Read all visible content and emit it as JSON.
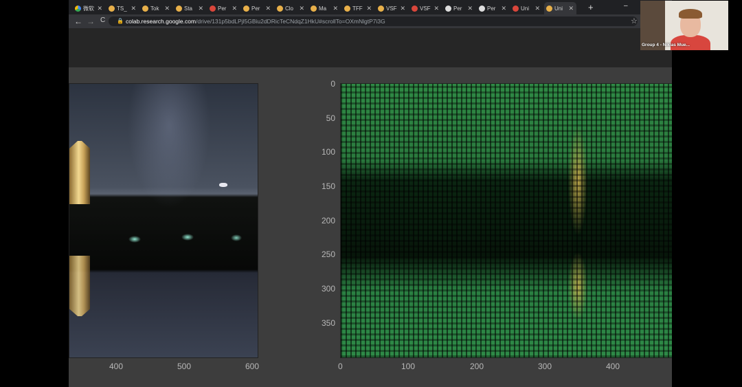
{
  "browser": {
    "tabs": [
      {
        "label": "微软",
        "icon": "google-drive-icon"
      },
      {
        "label": "TS_",
        "icon": "colab-icon"
      },
      {
        "label": "Tok",
        "icon": "colab-icon"
      },
      {
        "label": "Sta",
        "icon": "colab-icon"
      },
      {
        "label": "Per",
        "icon": "red-logo-icon"
      },
      {
        "label": "Per",
        "icon": "colab-icon"
      },
      {
        "label": "Clo",
        "icon": "colab-icon"
      },
      {
        "label": "Ma",
        "icon": "colab-icon"
      },
      {
        "label": "TFF",
        "icon": "colab-icon"
      },
      {
        "label": "VSF",
        "icon": "colab-icon"
      },
      {
        "label": "VSF",
        "icon": "red-logo-icon"
      },
      {
        "label": "Per",
        "icon": "github-icon"
      },
      {
        "label": "Per",
        "icon": "github-icon"
      },
      {
        "label": "Uni",
        "icon": "red-logo-icon"
      },
      {
        "label": "Uni",
        "icon": "colab-icon"
      }
    ],
    "new_tab": "+",
    "window_controls": [
      "–",
      "❐",
      "✕"
    ],
    "nav": {
      "back": "←",
      "forward": "→",
      "reload": "C"
    },
    "url_host": "colab.research.google.com",
    "url_path": "/drive/131p5bdLPjl5GBiu2dDRicTeCNdqZ1HkU#scrollTo=OXmNlgtP7i3G"
  },
  "meeting": {
    "participant_label": "Group 4 - Niklas Mue..."
  },
  "left_plot": {
    "x_ticks": [
      "400",
      "500",
      "600"
    ]
  },
  "right_plot": {
    "x_ticks": [
      "0",
      "100",
      "200",
      "300",
      "400"
    ],
    "y_ticks": [
      "0",
      "50",
      "100",
      "150",
      "200",
      "250",
      "300",
      "350"
    ]
  },
  "colors": {
    "matrix_green": "#2e8a47",
    "page_bg": "#3d3d3d",
    "tab_strip": "#202124"
  }
}
